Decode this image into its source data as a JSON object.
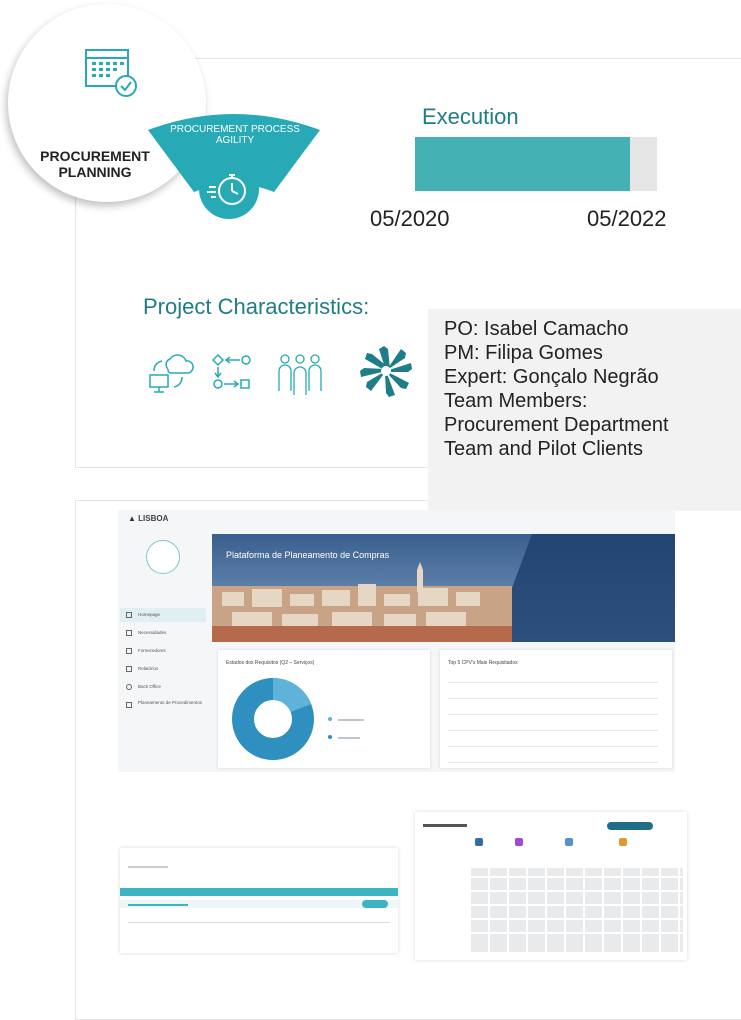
{
  "header": {
    "planning_title": "PROCUREMENT PLANNING",
    "agility_label": "PROCUREMENT PROCESS AGILITY"
  },
  "execution": {
    "label": "Execution",
    "progress_fraction": 0.89,
    "start_date": "05/2020",
    "end_date": "05/2022"
  },
  "characteristics": {
    "title": "Project Characteristics:",
    "icons": [
      "cloud-computer-icon",
      "process-flow-icon",
      "team-icon",
      "collaboration-hands-icon"
    ]
  },
  "team": {
    "lines": [
      "PO: Isabel Camacho",
      "PM: Filipa Gomes",
      "Expert: Gonçalo Negrão",
      "Team Members:",
      "Procurement Department",
      "Team and Pilot Clients"
    ]
  },
  "dashboard": {
    "logo": "LISBOA",
    "hero_title": "Plataforma de Planeamento de Compras",
    "nav": [
      "Homepage",
      "Necessidades",
      "Fornecedores",
      "Relatórios",
      "Back Office",
      "Planeamento de Procedimentos"
    ],
    "donut_card_title": "Estados dos Requisitos (Q2 – Serviços)",
    "top5_card_title": "Top 5 CPV's Mais Requisitados"
  },
  "colors": {
    "teal": "#27aab5",
    "dark_teal": "#1e7d88",
    "progress": "#44b1b5"
  }
}
